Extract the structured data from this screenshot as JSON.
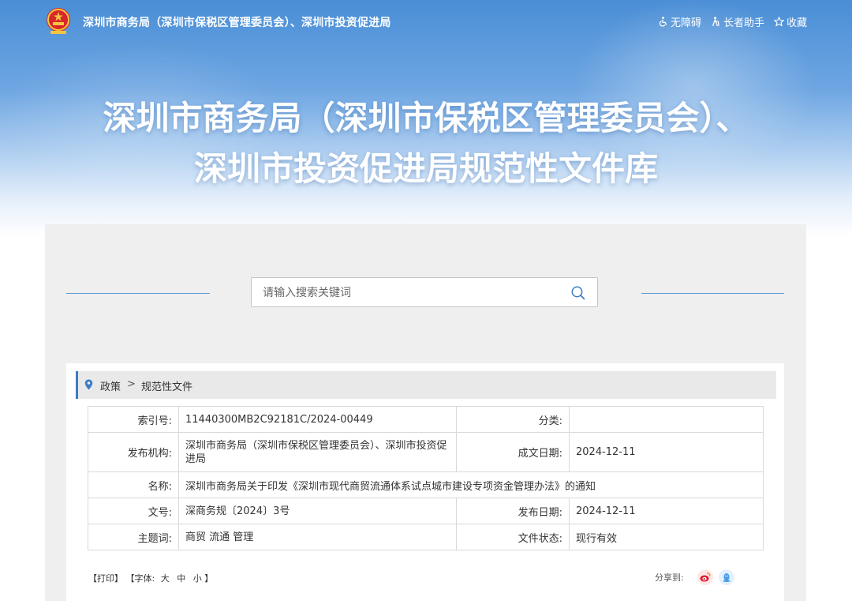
{
  "header": {
    "site_name": "深圳市商务局（深圳市保税区管理委员会）、深圳市投资促进局",
    "tools": {
      "accessibility": "无障碍",
      "elder_helper": "长者助手",
      "favorite": "收藏"
    }
  },
  "hero": {
    "title_line1": "深圳市商务局（深圳市保税区管理委员会）、",
    "title_line2": "深圳市投资促进局规范性文件库"
  },
  "search": {
    "placeholder": "请输入搜索关键词",
    "value": ""
  },
  "breadcrumb": {
    "level1": "政策",
    "separator": ">",
    "level2": "规范性文件"
  },
  "meta": {
    "index_label": "索引号:",
    "index_value": "11440300MB2C92181C/2024-00449",
    "category_label": "分类:",
    "category_value": "",
    "publisher_label": "发布机构:",
    "publisher_value": "深圳市商务局（深圳市保税区管理委员会）、深圳市投资促进局",
    "created_label": "成文日期:",
    "created_value": "2024-12-11",
    "name_label": "名称:",
    "name_value": "深圳市商务局关于印发《深圳市现代商贸流通体系试点城市建设专项资金管理办法》的通知",
    "docno_label": "文号:",
    "docno_value": "深商务规〔2024〕3号",
    "pubdate_label": "发布日期:",
    "pubdate_value": "2024-12-11",
    "subject_label": "主题词:",
    "subject_value": "商贸 流通 管理",
    "status_label": "文件状态:",
    "status_value": "现行有效"
  },
  "footer": {
    "print": "【打印】",
    "font_prefix": "【字体:",
    "font_large": "大",
    "font_medium": "中",
    "font_small": "小",
    "font_suffix": "】",
    "share_label": "分享到:"
  },
  "colors": {
    "accent": "#3a7cc4",
    "weibo": "#e6162d",
    "qq": "#4a9ee8"
  },
  "icons": {
    "weibo": "weibo-icon",
    "qq": "qq-icon"
  }
}
